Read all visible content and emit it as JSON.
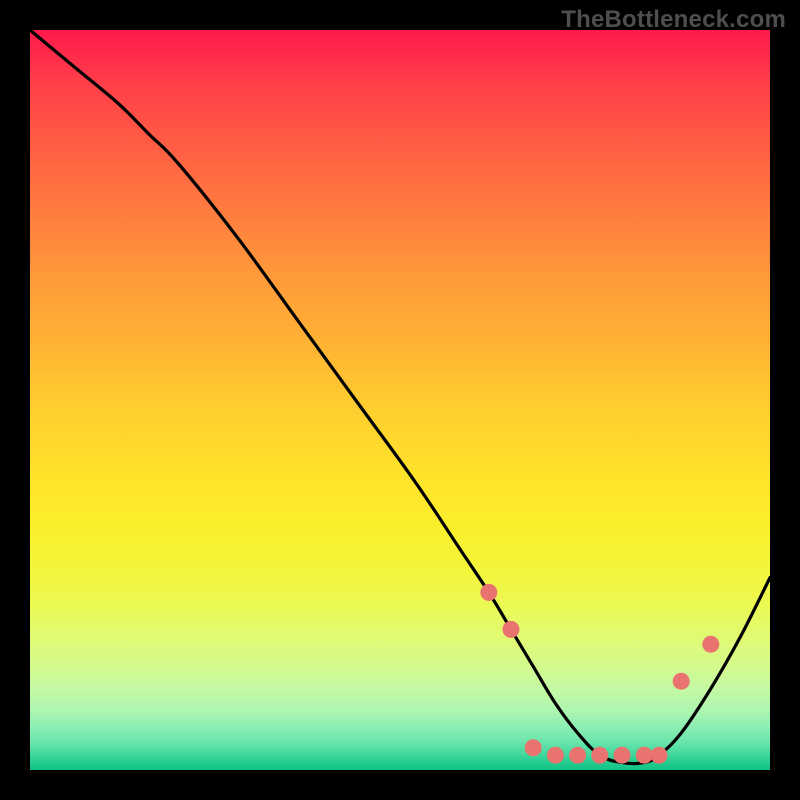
{
  "watermark": "TheBottleneck.com",
  "chart_data": {
    "type": "line",
    "title": "",
    "xlabel": "",
    "ylabel": "",
    "xlim": [
      0,
      100
    ],
    "ylim": [
      0,
      100
    ],
    "grid": false,
    "line": {
      "x": [
        0,
        6,
        12,
        16,
        20,
        28,
        36,
        44,
        52,
        58,
        62,
        65,
        68,
        71,
        74,
        77,
        80,
        83,
        85,
        88,
        92,
        96,
        100
      ],
      "y": [
        100,
        95,
        90,
        86,
        82,
        72,
        61,
        50,
        39,
        30,
        24,
        19,
        14,
        9,
        5,
        2,
        1,
        1,
        2,
        5,
        11,
        18,
        26
      ]
    },
    "markers": {
      "x": [
        62,
        65,
        68,
        71,
        74,
        77,
        80,
        83,
        85,
        88,
        92
      ],
      "y": [
        24,
        19,
        3,
        2,
        2,
        2,
        2,
        2,
        2,
        12,
        17
      ]
    }
  }
}
